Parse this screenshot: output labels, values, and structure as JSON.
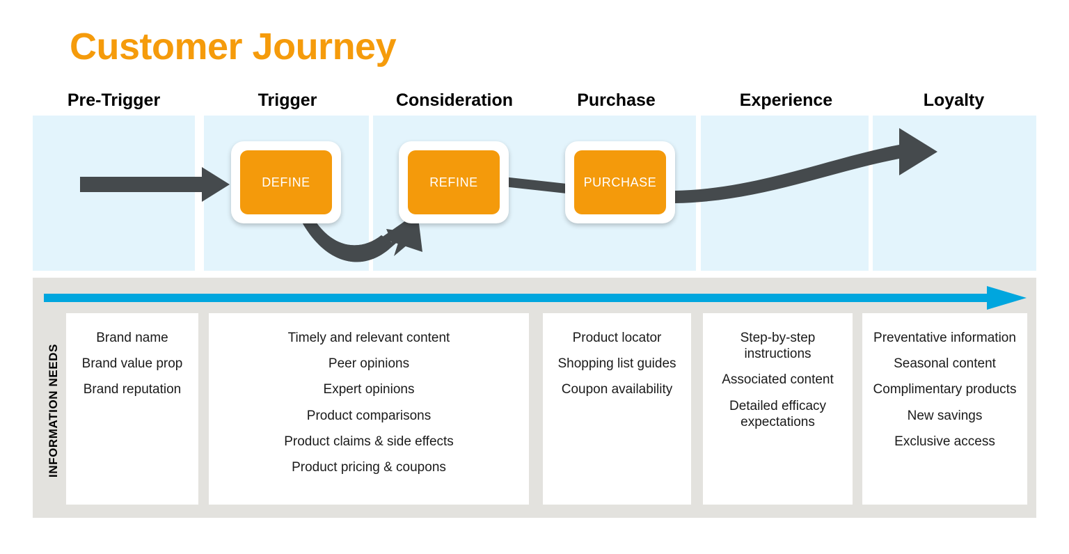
{
  "title": "Customer Journey",
  "colors": {
    "title_orange": "#F59B0B",
    "milestone_orange": "#F49A0B",
    "panel_blue": "#E3F4FC",
    "needs_gray": "#E3E2DE",
    "timeline_cyan": "#00A6DE",
    "arrow_gray": "#454A4D"
  },
  "stages": [
    {
      "label": "Pre-Trigger"
    },
    {
      "label": "Trigger"
    },
    {
      "label": "Consideration"
    },
    {
      "label": "Purchase"
    },
    {
      "label": "Experience"
    },
    {
      "label": "Loyalty"
    }
  ],
  "milestones": [
    {
      "label": "DEFINE"
    },
    {
      "label": "REFINE"
    },
    {
      "label": "PURCHASE"
    }
  ],
  "needs": {
    "axis_label": "INFORMATION NEEDS",
    "columns": [
      {
        "stage": "Pre-Trigger",
        "items": [
          "Brand name",
          "Brand value prop",
          "Brand reputation"
        ]
      },
      {
        "stage": "Trigger / Consideration",
        "items": [
          "Timely and relevant content",
          "Peer opinions",
          "Expert opinions",
          "Product comparisons",
          "Product claims & side effects",
          "Product pricing & coupons"
        ]
      },
      {
        "stage": "Purchase",
        "items": [
          "Product locator",
          "Shopping list guides",
          "Coupon availability"
        ]
      },
      {
        "stage": "Experience",
        "items": [
          "Step-by-step instructions",
          "Associated content",
          "Detailed efficacy expectations"
        ]
      },
      {
        "stage": "Loyalty",
        "items": [
          "Preventative information",
          "Seasonal content",
          "Complimentary products",
          "New savings",
          "Exclusive access"
        ]
      }
    ]
  }
}
